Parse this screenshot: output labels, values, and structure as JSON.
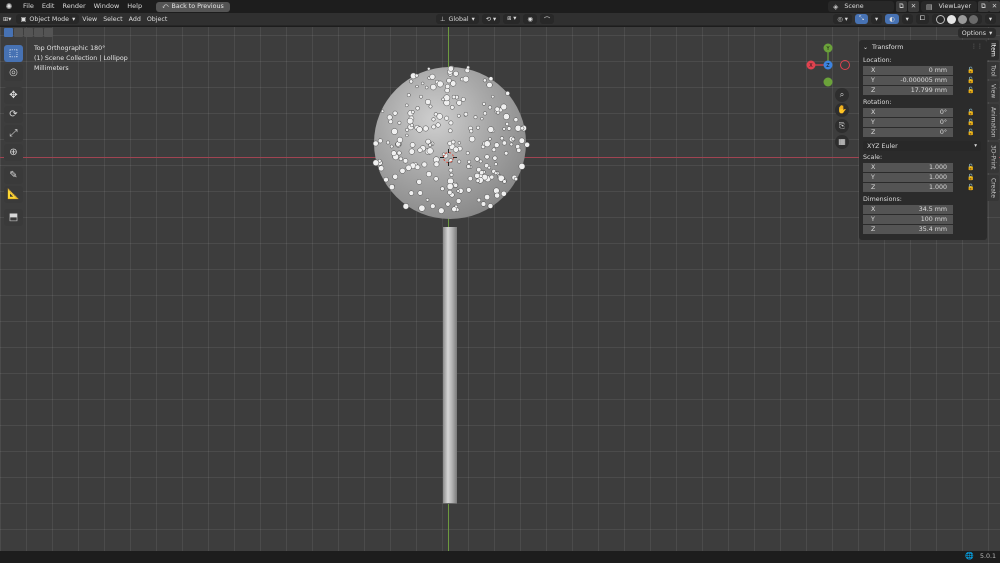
{
  "topbar": {
    "logo_icon": "blender-logo-icon",
    "menus": [
      "File",
      "Edit",
      "Render",
      "Window",
      "Help"
    ],
    "back_button": "Back to Previous",
    "scene_label": "Scene",
    "view_layer_label": "ViewLayer"
  },
  "header": {
    "mode": "Object Mode",
    "menus": [
      "View",
      "Select",
      "Add",
      "Object"
    ],
    "orientation": "Global",
    "options_label": "Options"
  },
  "viewport": {
    "view_name": "Top Orthographic 180°",
    "collection": "(1) Scene Collection | Lollipop",
    "units": "Millimeters",
    "gizmo": {
      "x_label": "X",
      "y_label": "Y",
      "z_label": "Z",
      "colors": {
        "x": "#e0424f",
        "y": "#6ba23a",
        "z": "#3c83e0"
      }
    }
  },
  "npanel": {
    "section": "Transform",
    "location_label": "Location:",
    "location": [
      {
        "axis": "X",
        "value": "0 mm"
      },
      {
        "axis": "Y",
        "value": "-0.000005 mm"
      },
      {
        "axis": "Z",
        "value": "17.799 mm"
      }
    ],
    "rotation_label": "Rotation:",
    "rotation": [
      {
        "axis": "X",
        "value": "0°"
      },
      {
        "axis": "Y",
        "value": "0°"
      },
      {
        "axis": "Z",
        "value": "0°"
      }
    ],
    "rotation_mode": "XYZ Euler",
    "scale_label": "Scale:",
    "scale": [
      {
        "axis": "X",
        "value": "1.000"
      },
      {
        "axis": "Y",
        "value": "1.000"
      },
      {
        "axis": "Z",
        "value": "1.000"
      }
    ],
    "dimensions_label": "Dimensions:",
    "dimensions": [
      {
        "axis": "X",
        "value": "34.5 mm"
      },
      {
        "axis": "Y",
        "value": "100 mm"
      },
      {
        "axis": "Z",
        "value": "35.4 mm"
      }
    ]
  },
  "tabs": [
    "Item",
    "Tool",
    "View",
    "Animation",
    "3D-Print",
    "Create"
  ],
  "status": {
    "version": "5.0.1"
  }
}
